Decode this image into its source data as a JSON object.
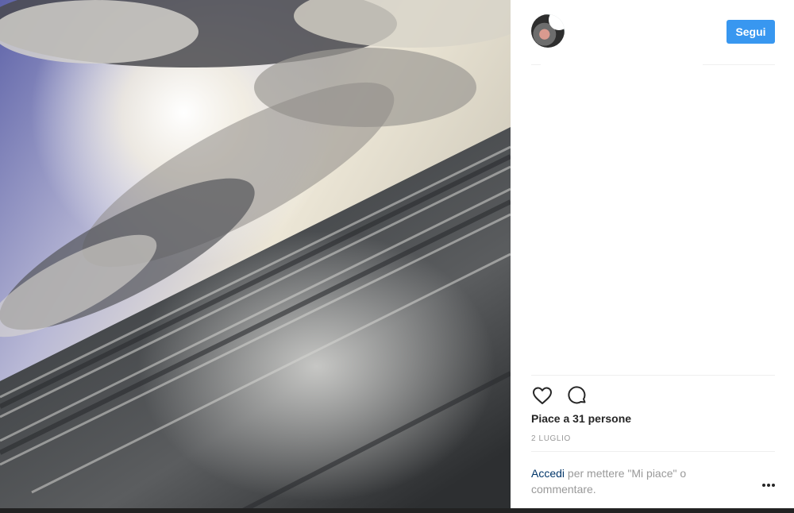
{
  "post": {
    "image_icon": "seascape-photo",
    "follow_label": "Segui",
    "likes_text": "Piace a 31 persone",
    "date_text": "2 LUGLIO",
    "login_link": "Accedi",
    "login_rest": " per mettere \"Mi piace\" o commentare."
  },
  "colors": {
    "follow_button": "#3897f0",
    "link": "#003569",
    "muted": "#999999"
  },
  "icons": {
    "like": "heart-icon",
    "comment": "comment-icon",
    "more": "more-options-icon"
  }
}
